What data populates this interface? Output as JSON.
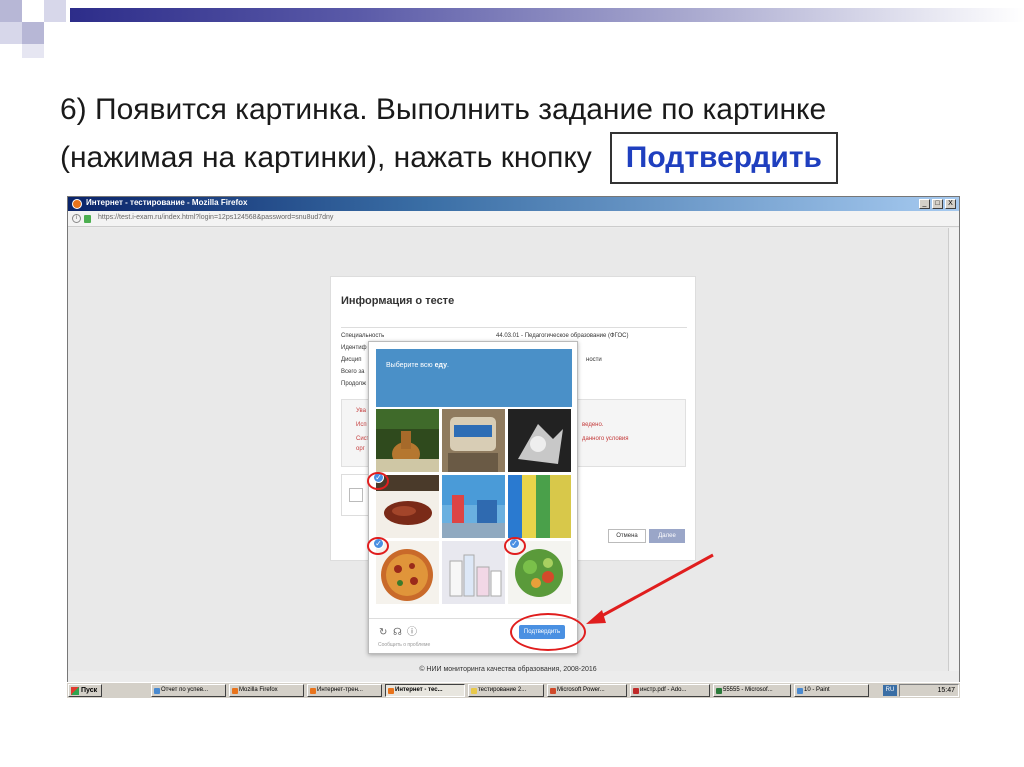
{
  "slide": {
    "title_line1": "6) Появится картинка. Выполнить задание по картинке",
    "title_line2": "(нажимая на картинки), нажать кнопку",
    "highlight_button": "Подтвердить"
  },
  "browser": {
    "window_title": "Интернет - тестирование - Mozilla Firefox",
    "url": "https://test.i-exam.ru/index.html?login=12ps124568&password=snu8ud7dny",
    "window_buttons": [
      "_",
      "□",
      "X"
    ],
    "footer": "© НИИ мониторинга качества образования, 2008-2016"
  },
  "info_panel": {
    "title": "Информация о тесте",
    "rows": [
      {
        "label": "Специальность",
        "value": "44.03.01 - Педагогическое образование (ФГОС)"
      },
      {
        "label": "Идентиф",
        "value": ""
      },
      {
        "label": "Дисцип",
        "value": "ности"
      },
      {
        "label": "Всего за",
        "value": ""
      },
      {
        "label": "Продолж",
        "value": ""
      }
    ],
    "warning_left": [
      "Ува",
      "Исп",
      "Сист",
      "орг"
    ],
    "warning_right": [
      "ведено.",
      "данного условия"
    ],
    "cancel_label": "Отмена",
    "next_label": "Далее"
  },
  "captcha": {
    "prompt_prefix": "Выберите всю ",
    "prompt_bold": "еду",
    "prompt_suffix": ".",
    "verify_label": "Подтвердить",
    "report_label": "Сообщить о проблеме",
    "tiles": [
      {
        "name": "tile-statue",
        "selected": false
      },
      {
        "name": "tile-jars",
        "selected": false
      },
      {
        "name": "tile-sculpture",
        "selected": false
      },
      {
        "name": "tile-steak",
        "selected": true
      },
      {
        "name": "tile-street",
        "selected": false
      },
      {
        "name": "tile-fabric",
        "selected": false
      },
      {
        "name": "tile-pizza",
        "selected": true
      },
      {
        "name": "tile-bottles",
        "selected": false
      },
      {
        "name": "tile-salad",
        "selected": true
      }
    ]
  },
  "taskbar": {
    "start_label": "Пуск",
    "items": [
      "Отчет по успев...",
      "Mozilla Firefox",
      "Интернет-трен...",
      "Интернет - тес...",
      "тестирование 2...",
      "Microsoft Power...",
      "инстр.pdf - Ado...",
      "55555 - Microsof...",
      "10 - Paint"
    ],
    "active_index": 3,
    "language": "RU",
    "clock": "15:47"
  },
  "colors": {
    "accent_blue": "#1f3fbf",
    "captcha_header": "#4a90c8",
    "verify_button": "#4a90e2",
    "annotation_red": "#e01e1e"
  }
}
